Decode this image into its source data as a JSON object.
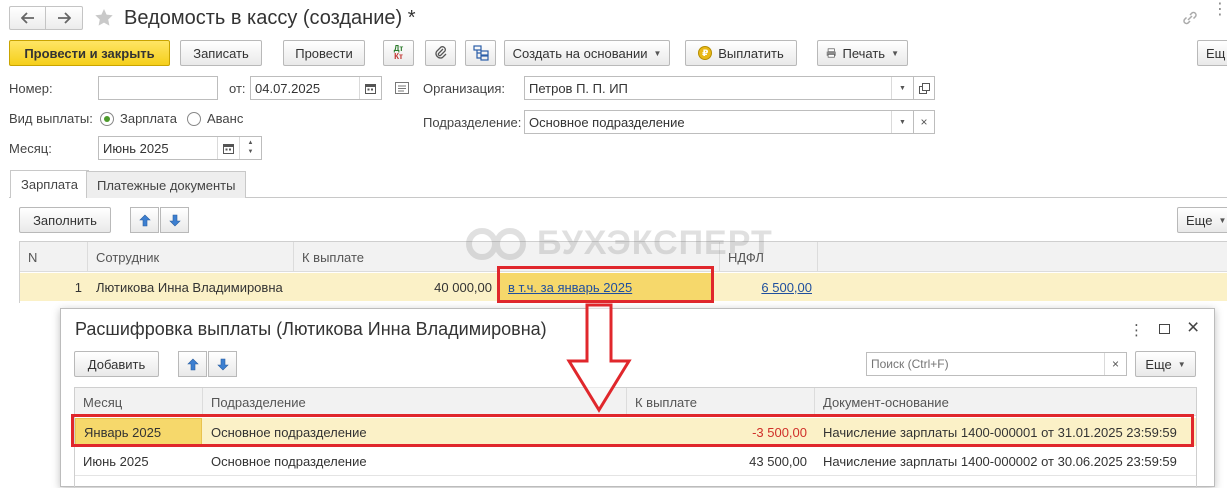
{
  "window": {
    "title": "Ведомость в кассу (создание) *"
  },
  "toolbar": {
    "post_close": "Провести и закрыть",
    "save": "Записать",
    "post": "Провести",
    "dtkt_top": "Дт",
    "dtkt_bottom": "Кт",
    "create_based": "Создать на основании",
    "pay": "Выплатить",
    "print": "Печать",
    "more": "Ещ"
  },
  "form": {
    "number_label": "Номер:",
    "number_value": "",
    "date_label": "от:",
    "date_value": "04.07.2025",
    "org_label": "Организация:",
    "org_value": "Петров П. П. ИП",
    "paytype_label": "Вид выплаты:",
    "paytype_options": [
      "Зарплата",
      "Аванс"
    ],
    "paytype_selected": "Зарплата",
    "dept_label": "Подразделение:",
    "dept_value": "Основное подразделение",
    "month_label": "Месяц:",
    "month_value": "Июнь 2025"
  },
  "tabs": [
    "Зарплата",
    "Платежные документы"
  ],
  "salary_tab": {
    "fill": "Заполнить",
    "more": "Еще",
    "columns": [
      "N",
      "Сотрудник",
      "К выплате",
      "",
      "НДФЛ"
    ],
    "rows": [
      {
        "n": "1",
        "employee": "Лютикова Инна Владимировна",
        "to_pay": "40 000,00",
        "incl": "в т.ч. за январь 2025",
        "ndfl": "6 500,00"
      }
    ]
  },
  "watermark": "БУХЭКСПЕРТ",
  "popup": {
    "title": "Расшифровка выплаты (Лютикова Инна Владимировна)",
    "add": "Добавить",
    "search_placeholder": "Поиск (Ctrl+F)",
    "more": "Еще",
    "columns": [
      "Месяц",
      "Подразделение",
      "К выплате",
      "Документ-основание"
    ],
    "rows": [
      {
        "month": "Январь 2025",
        "dept": "Основное подразделение",
        "to_pay": "-3 500,00",
        "doc": "Начисление зарплаты 1400-000001 от 31.01.2025 23:59:59"
      },
      {
        "month": "Июнь 2025",
        "dept": "Основное подразделение",
        "to_pay": "43 500,00",
        "doc": "Начисление зарплаты 1400-000002 от 30.06.2025 23:59:59"
      }
    ]
  },
  "colors": {
    "accent_yellow": "#f5cf1a",
    "row_highlight": "#fbf1c7",
    "annotation_red": "#e0272c",
    "negative_red": "#d0302a",
    "link_blue": "#1f4f9e"
  },
  "icons": [
    "back-arrow-icon",
    "forward-arrow-icon",
    "star-icon",
    "link-icon",
    "dtkt-icon",
    "paperclip-icon",
    "structure-icon",
    "ruble-coin-icon",
    "printer-icon",
    "calendar-icon",
    "document-icon",
    "arrow-up-icon",
    "arrow-down-icon",
    "kebab-menu-icon",
    "maximize-icon",
    "close-icon",
    "clear-icon"
  ]
}
